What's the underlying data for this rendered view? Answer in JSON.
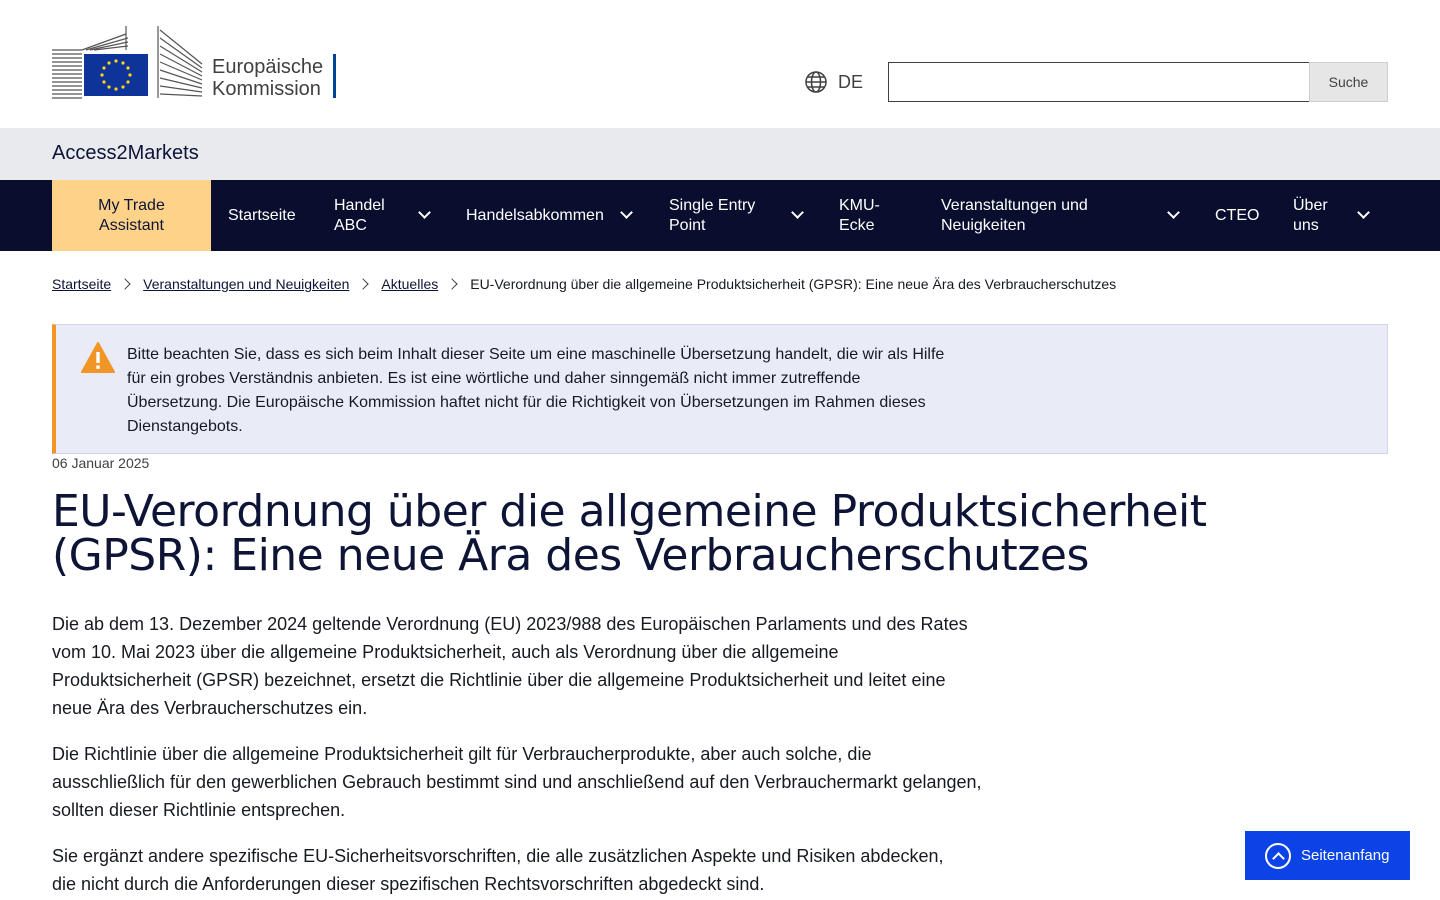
{
  "header": {
    "logo_line1": "Europäische",
    "logo_line2": "Kommission",
    "language": "DE",
    "search_placeholder": "",
    "search_button": "Suche"
  },
  "site_name": "Access2Markets",
  "nav": {
    "items": [
      {
        "label": "My Trade Assistant"
      },
      {
        "label": "Startseite"
      },
      {
        "label": "Handel ABC"
      },
      {
        "label": "Handelsabkommen"
      },
      {
        "label": "Single Entry Point"
      },
      {
        "label": "KMU-Ecke"
      },
      {
        "label": "Veranstaltungen und Neuigkeiten"
      },
      {
        "label": "CTEO"
      },
      {
        "label": "Über uns"
      }
    ]
  },
  "breadcrumb": {
    "items": [
      {
        "label": "Startseite"
      },
      {
        "label": "Veranstaltungen und Neuigkeiten"
      },
      {
        "label": "Aktuelles"
      }
    ],
    "current": "EU-Verordnung über die allgemeine Produktsicherheit (GPSR): Eine neue Ära des Verbraucherschutzes"
  },
  "notice": {
    "text": "Bitte beachten Sie, dass es sich beim Inhalt dieser Seite um eine maschinelle Übersetzung handelt, die wir als Hilfe für ein grobes Verständnis anbieten. Es ist eine wörtliche und daher sinngemäß nicht immer zutreffende Übersetzung. Die Europäische Kommission haftet nicht für die Richtigkeit von Übersetzungen im Rahmen dieses Dienstangebots."
  },
  "article": {
    "date": "06 Januar 2025",
    "title": "EU-Verordnung über die allgemeine Produktsicherheit (GPSR): Eine neue Ära des Verbraucherschutzes",
    "paragraphs": [
      "Die ab dem 13. Dezember 2024 geltende Verordnung (EU) 2023/988 des Europäischen Parlaments und des Rates vom 10. Mai 2023 über die allgemeine Produktsicherheit, auch als Verordnung über die allgemeine Produktsicherheit (GPSR) bezeichnet, ersetzt die Richtlinie über die allgemeine Produktsicherheit und leitet eine neue Ära des Verbraucherschutzes ein.",
      "Die Richtlinie über die allgemeine Produktsicherheit gilt für Verbraucherprodukte, aber auch solche, die ausschließlich für den gewerblichen Gebrauch bestimmt sind und anschließend auf den Verbrauchermarkt gelangen, sollten dieser Richtlinie entsprechen.",
      "Sie ergänzt andere spezifische EU-Sicherheitsvorschriften, die alle zusätzlichen Aspekte und Risiken abdecken, die nicht durch die Anforderungen dieser spezifischen Rechtsvorschriften abgedeckt sind."
    ]
  },
  "back_to_top": "Seitenanfang",
  "colors": {
    "nav_bg": "#090e2e",
    "highlight": "#fed389",
    "accent": "#0b43e6",
    "warning": "#f29527"
  }
}
